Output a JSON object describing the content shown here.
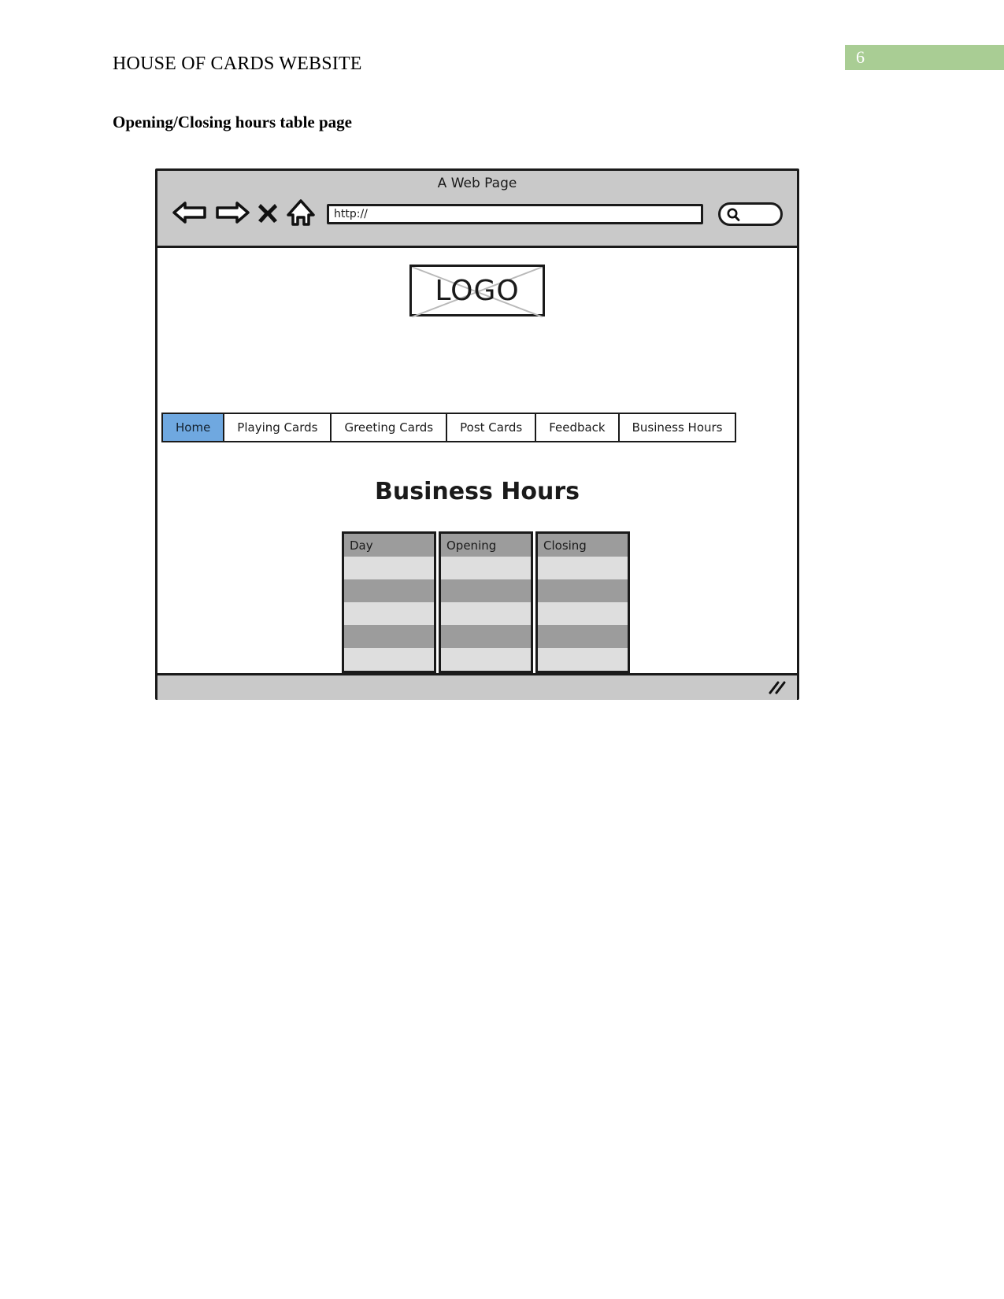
{
  "document": {
    "header_title": "HOUSE OF CARDS WEBSITE",
    "page_number": "6",
    "page_number_color": "#a9cd94",
    "section_title": "Opening/Closing hours table page"
  },
  "browser": {
    "window_title": "A Web Page",
    "controls": [
      {
        "name": "back-icon",
        "label": "Back"
      },
      {
        "name": "forward-icon",
        "label": "Forward"
      },
      {
        "name": "stop-icon",
        "label": "Stop"
      },
      {
        "name": "home-icon",
        "label": "Home"
      }
    ],
    "address_bar": {
      "value": "http://",
      "placeholder": "http://"
    },
    "search_box": {
      "value": "",
      "placeholder": "",
      "icon": "search-icon"
    },
    "status_bar": {
      "text": "",
      "grip_icon": "resize-grip-icon"
    }
  },
  "site": {
    "logo": {
      "text": "LOGO",
      "placeholder_style": "crossed-box"
    },
    "nav": {
      "active_index": 0,
      "items": [
        {
          "label": "Home"
        },
        {
          "label": "Playing Cards"
        },
        {
          "label": "Greeting Cards"
        },
        {
          "label": "Post Cards"
        },
        {
          "label": "Feedback"
        },
        {
          "label": "Business Hours"
        }
      ],
      "active_color": "#6fa8e0"
    },
    "page": {
      "heading": "Business Hours",
      "table": {
        "columns": [
          {
            "header": "Day"
          },
          {
            "header": "Opening"
          },
          {
            "header": "Closing"
          }
        ],
        "rows": [
          {
            "day": "",
            "opening": "",
            "closing": ""
          },
          {
            "day": "",
            "opening": "",
            "closing": ""
          },
          {
            "day": "",
            "opening": "",
            "closing": ""
          },
          {
            "day": "",
            "opening": "",
            "closing": ""
          },
          {
            "day": "",
            "opening": "",
            "closing": ""
          }
        ],
        "row_colors": {
          "header": "#9c9c9c",
          "light": "#dedede",
          "dark": "#9c9c9c"
        }
      }
    }
  }
}
